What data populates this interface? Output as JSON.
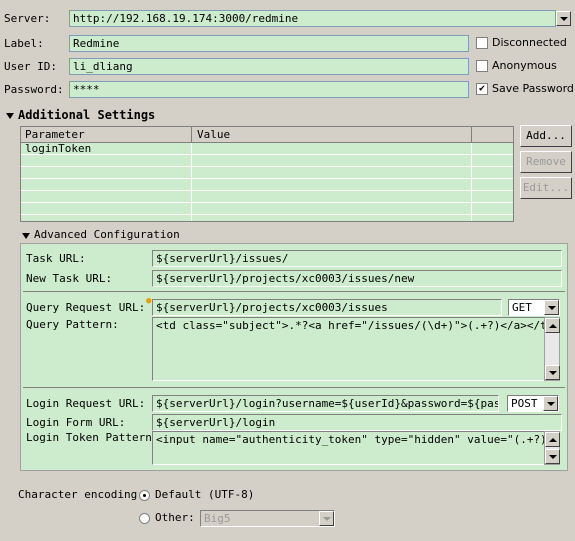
{
  "connection": {
    "server_label": "Server:",
    "server_value": "http://192.168.19.174:3000/redmine",
    "label_label": "Label:",
    "label_value": "Redmine",
    "userid_label": "User ID:",
    "userid_value": "li_dliang",
    "password_label": "Password:",
    "password_value": "****",
    "disconnected_label": "Disconnected",
    "disconnected_checked": false,
    "anonymous_label": "Anonymous",
    "anonymous_checked": false,
    "save_password_label": "Save Password",
    "save_password_checked": true
  },
  "additional_settings": {
    "title": "Additional Settings",
    "columns": [
      "Parameter",
      "Value"
    ],
    "rows": [
      {
        "parameter": "loginToken",
        "value": ""
      }
    ],
    "add_label": "Add...",
    "remove_label": "Remove",
    "edit_label": "Edit..."
  },
  "advanced": {
    "title": "Advanced Configuration",
    "task_url_label": "Task URL:",
    "task_url_value": "${serverUrl}/issues/",
    "new_task_url_label": "New Task URL:",
    "new_task_url_value": "${serverUrl}/projects/xc0003/issues/new",
    "query_request_url_label": "Query Request URL:",
    "query_request_url_value": "${serverUrl}/projects/xc0003/issues",
    "query_method": "GET",
    "query_pattern_label": "Query Pattern:",
    "query_pattern_value": "<td class=\"subject\">.*?<a href=\"/issues/(\\d+)\">(.+?)</a></td>",
    "login_request_url_label": "Login Request URL:",
    "login_request_url_value": "${serverUrl}/login?username=${userId}&password=${password}",
    "login_method": "POST",
    "login_form_url_label": "Login Form URL:",
    "login_form_url_value": "${serverUrl}/login",
    "login_token_pattern_label": "Login Token Pattern:",
    "login_token_pattern_value": "<input name=\"authenticity_token\" type=\"hidden\" value=\"(.+?)\" />"
  },
  "encoding": {
    "label": "Character encoding:",
    "default_label": "Default (UTF-8)",
    "other_label": "Other:",
    "other_value": "Big5",
    "selected": "default"
  }
}
